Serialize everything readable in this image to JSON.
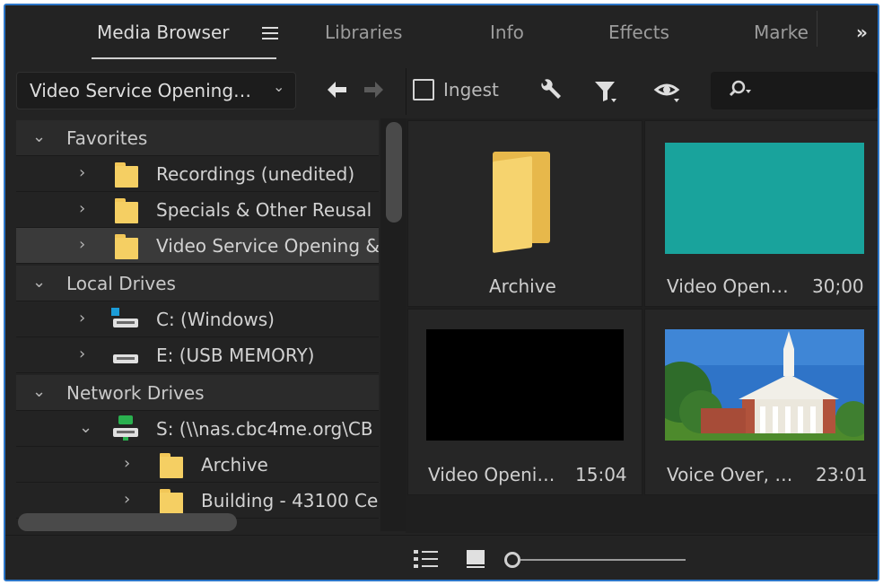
{
  "tabs": [
    {
      "label": "Media Browser",
      "active": true
    },
    {
      "label": "Libraries"
    },
    {
      "label": "Info"
    },
    {
      "label": "Effects"
    },
    {
      "label": "Marke"
    }
  ],
  "toolbar": {
    "path_value": "Video Service Opening…",
    "ingest_label": "Ingest",
    "ingest_checked": false,
    "search_value": ""
  },
  "tree": {
    "favorites": {
      "label": "Favorites",
      "items": [
        "Recordings (unedited)",
        "Specials & Other Reusal",
        "Video Service Opening &"
      ]
    },
    "local_drives": {
      "label": "Local Drives",
      "items": [
        "C: (Windows)",
        "E: (USB MEMORY)"
      ]
    },
    "network_drives": {
      "label": "Network Drives",
      "items": [
        "S: (\\\\nas.cbc4me.org\\CB"
      ],
      "children": [
        "Archive",
        "Building - 43100 Ce"
      ]
    }
  },
  "grid": [
    {
      "name": "Archive",
      "duration": "",
      "kind": "folder"
    },
    {
      "name": "Video Open…",
      "duration": "30;00",
      "kind": "teal-clip"
    },
    {
      "name": "Video Openi…",
      "duration": "15:04",
      "kind": "black-clip"
    },
    {
      "name": "Voice Over, …",
      "duration": "23:01",
      "kind": "church-photo"
    }
  ],
  "colors": {
    "accent_border": "#2c76c8",
    "panel_bg": "#232323",
    "folder_yellow": "#f5cf63",
    "teal_thumb": "#19a39c"
  },
  "icons": {
    "view_list": "list-view-icon",
    "view_icon": "icon-view-icon",
    "zoom": "zoom-slider"
  }
}
